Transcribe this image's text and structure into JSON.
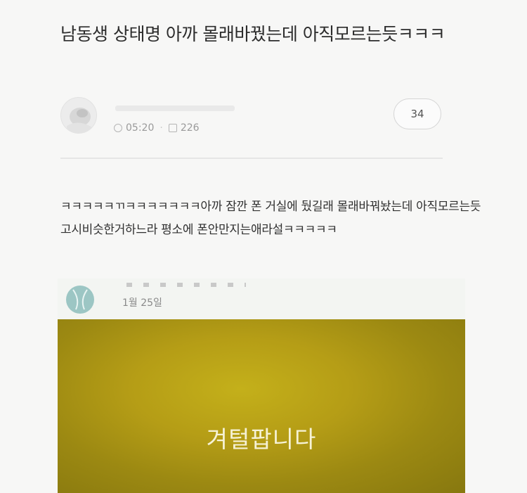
{
  "post": {
    "title": "남동생 상태명 아까 몰래바꿨는데 아직모르는듯ㅋㅋㅋ",
    "author_name": "",
    "time": "05:20",
    "views": "226",
    "comment_count": "34"
  },
  "body_text": "ㅋㅋㅋㅋㅋㄲㅋㅋㅋㅋㅋㅋㅋ아까 잠깐 폰 거실에 뒀길래 몰래바꿔놨는데 아직모르는듯 고시비슷한거하느라 평소에 폰안만지는애라설ㅋㅋㅋㅋㅋ",
  "embed": {
    "date": "1월 25일",
    "caption": "겨털팝니다",
    "image_color": "#b59d16"
  },
  "icons": [
    "avatar",
    "clock-icon",
    "view-count-icon",
    "comment-bubble"
  ]
}
